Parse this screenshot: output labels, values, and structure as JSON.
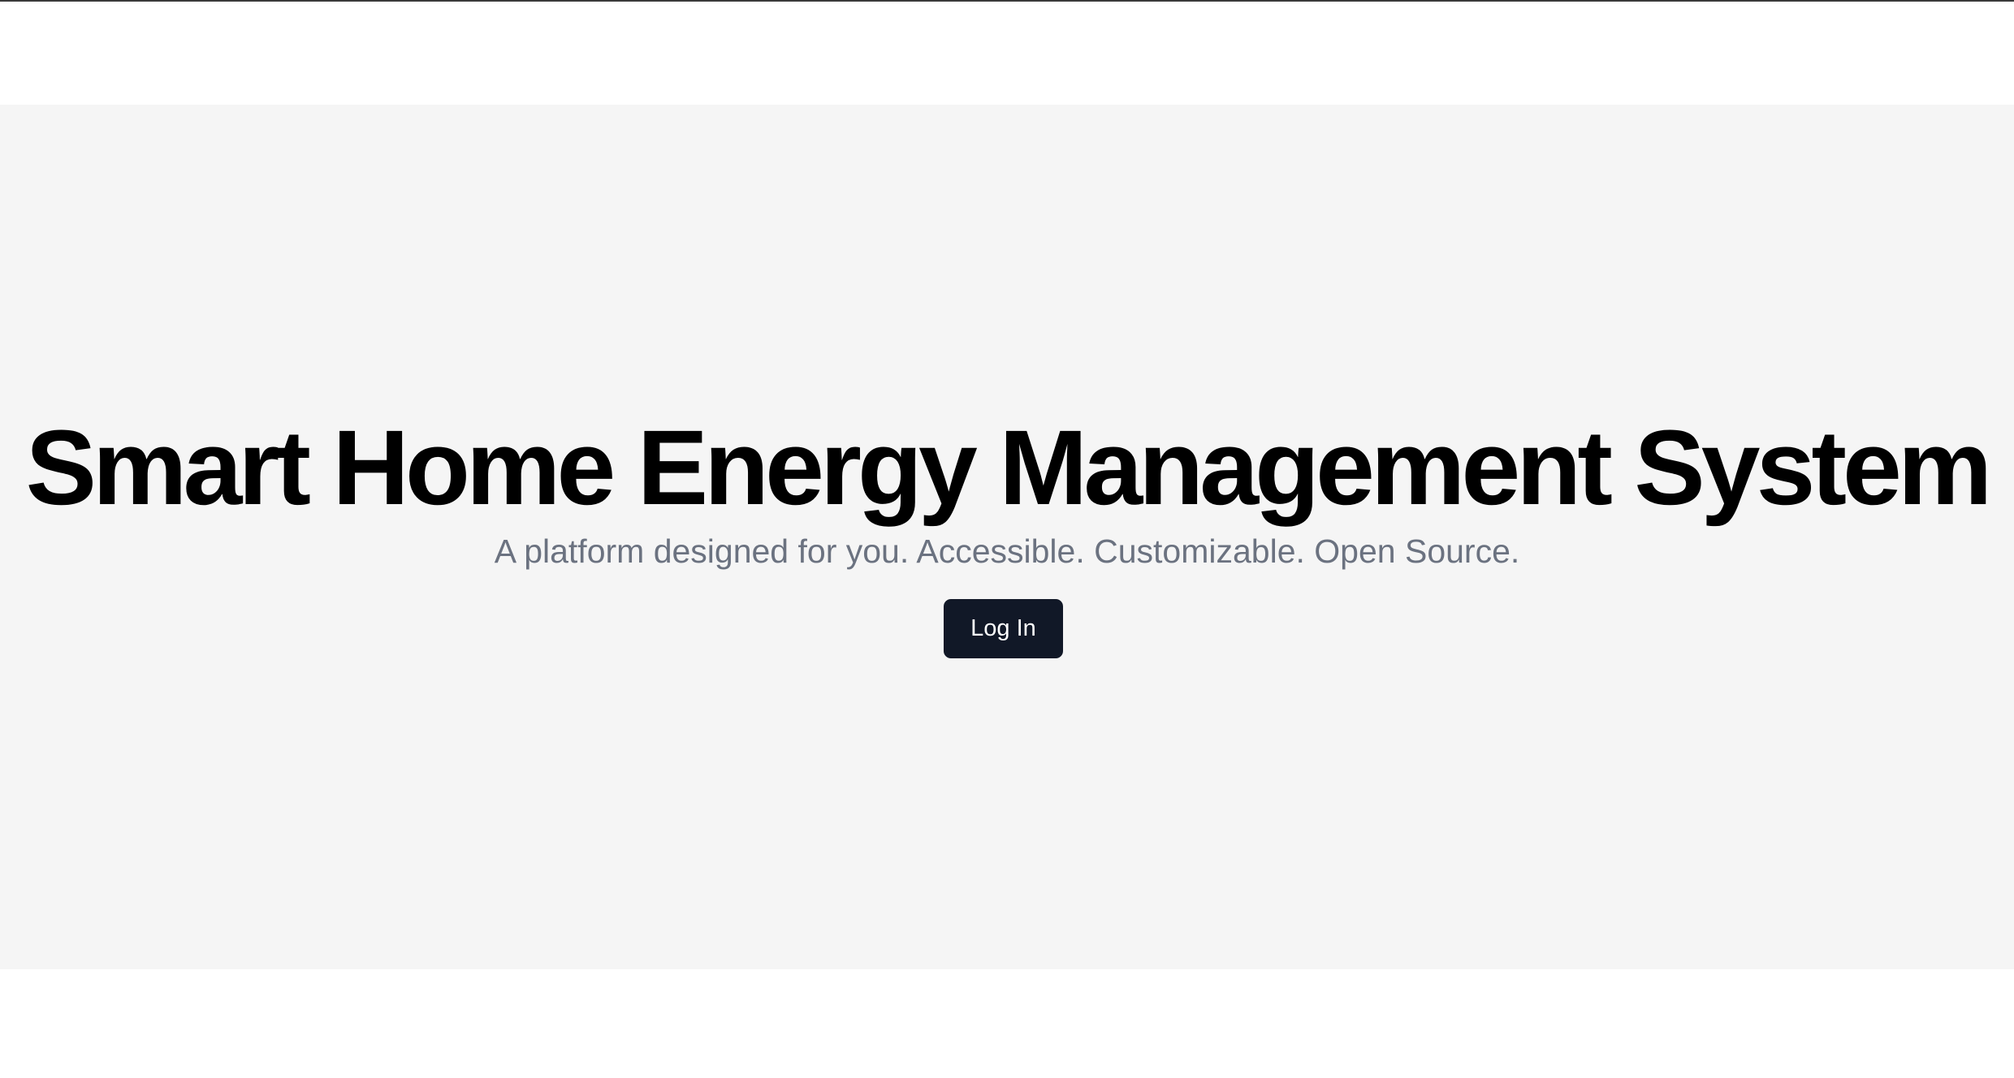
{
  "hero": {
    "title": "Smart Home Energy Management System",
    "subtitle": "A platform designed for you. Accessible. Customizable. Open Source.",
    "login_label": "Log In"
  },
  "colors": {
    "background": "#ffffff",
    "hero_background": "#f5f5f5",
    "title_text": "#000000",
    "subtitle_text": "#6b7280",
    "button_background": "#111827",
    "button_text": "#ffffff"
  }
}
